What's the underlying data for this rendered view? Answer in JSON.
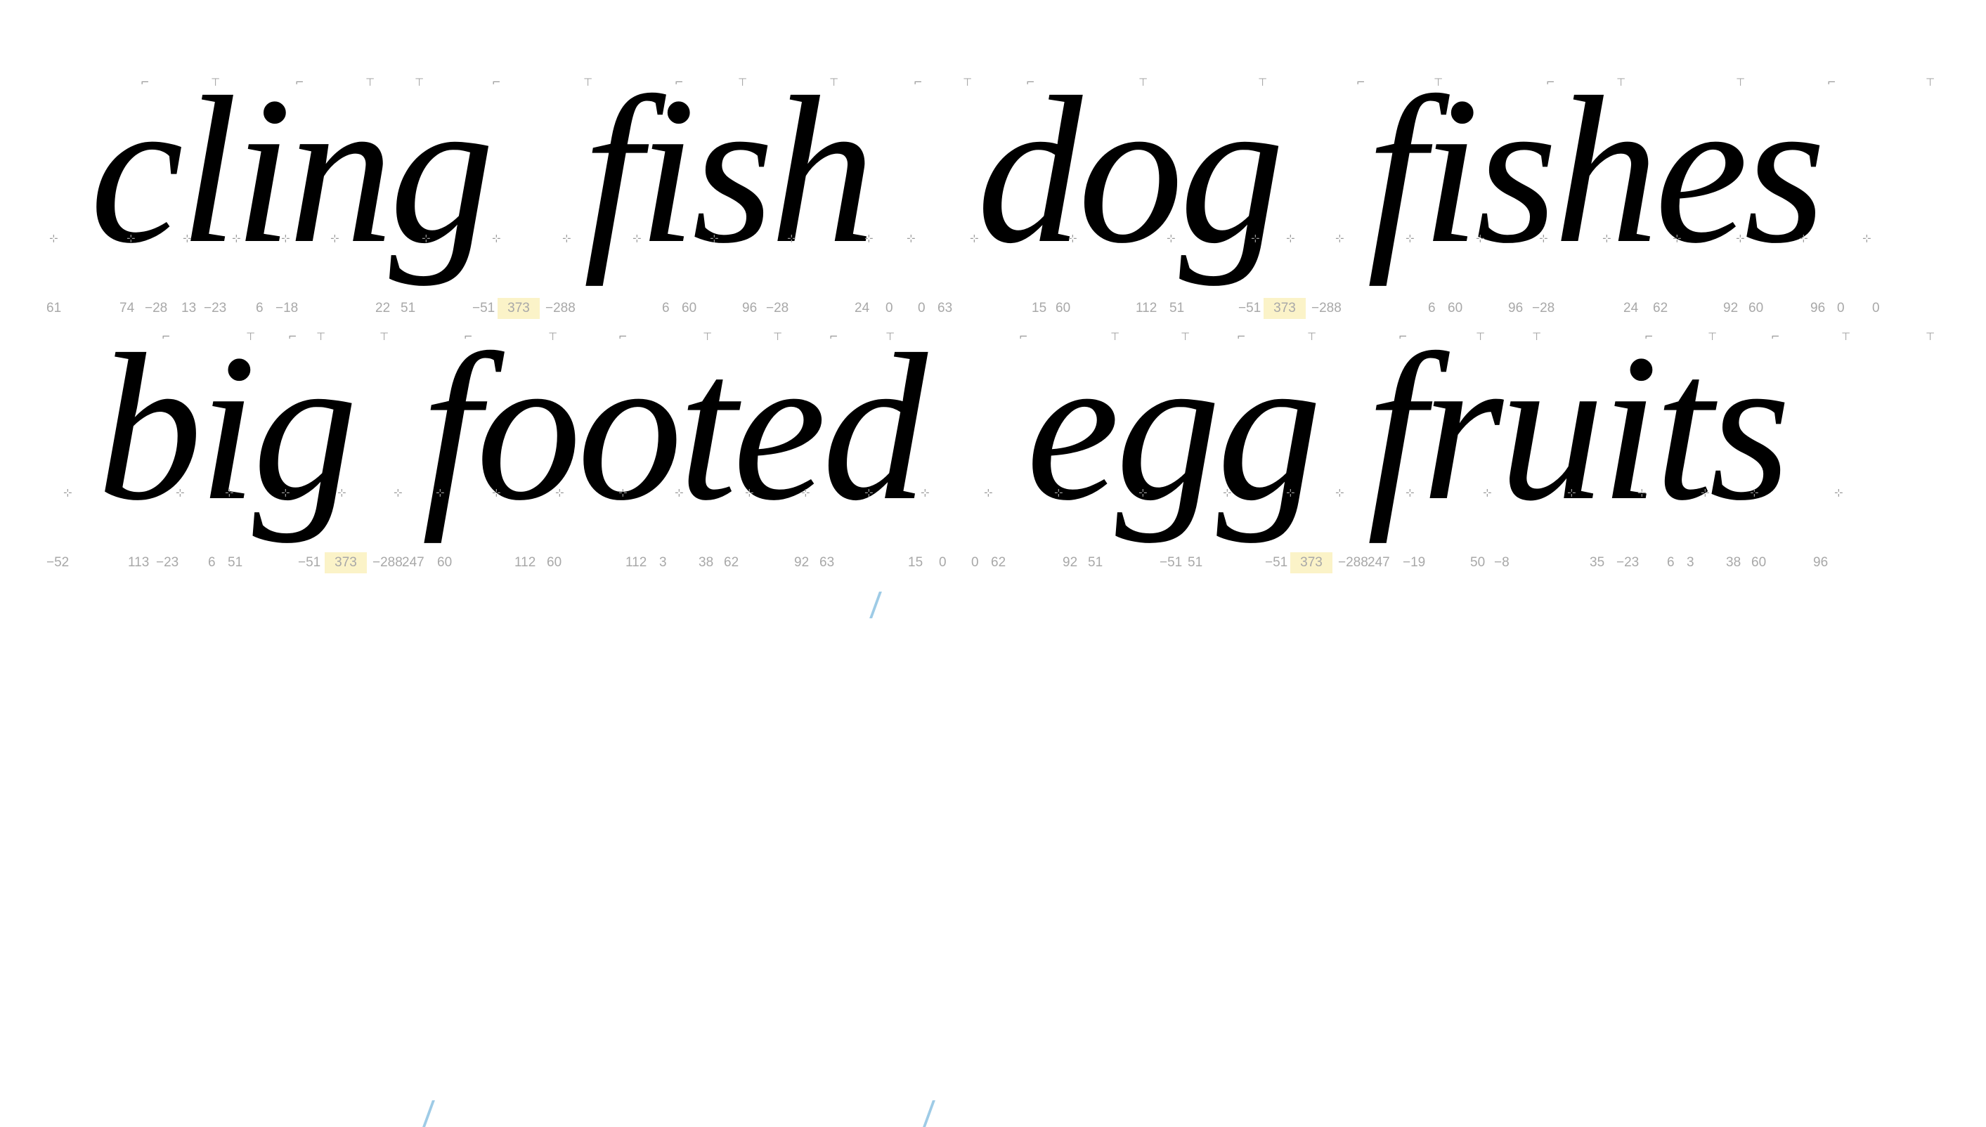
{
  "lines": [
    {
      "words": [
        "cling",
        "fish",
        "dog",
        "fishes"
      ]
    },
    {
      "words": [
        "big",
        "footed",
        "egg",
        "fruits"
      ]
    }
  ],
  "metrics": {
    "row1": [
      "61",
      "74",
      "−28",
      "13",
      "−23",
      "6",
      "−18",
      "22",
      "51",
      "−51",
      "373",
      "−288",
      "6",
      "60",
      "96",
      "−28",
      "24",
      "0",
      "0",
      "63",
      "15",
      "60",
      "112",
      "51",
      "−51",
      "373",
      "−288",
      "6",
      "60",
      "96",
      "−28",
      "24",
      "62",
      "92",
      "60",
      "96",
      "0",
      "0"
    ],
    "row2": [
      "−52",
      "113",
      "−23",
      "6",
      "51",
      "−51",
      "373",
      "−288",
      "247",
      "60",
      "112",
      "60",
      "112",
      "3",
      "38",
      "62",
      "92",
      "63",
      "15",
      "0",
      "0",
      "62",
      "92",
      "51",
      "−51",
      "51",
      "−51",
      "373",
      "−288",
      "247",
      "−19",
      "50",
      "−8",
      "35",
      "−23",
      "6",
      "3",
      "38",
      "60",
      "96"
    ]
  },
  "colors": {
    "text": "#000000",
    "metric_text": "#a8a8a8",
    "highlight": "#fbf3c8",
    "slash": "#9ecbe6"
  }
}
